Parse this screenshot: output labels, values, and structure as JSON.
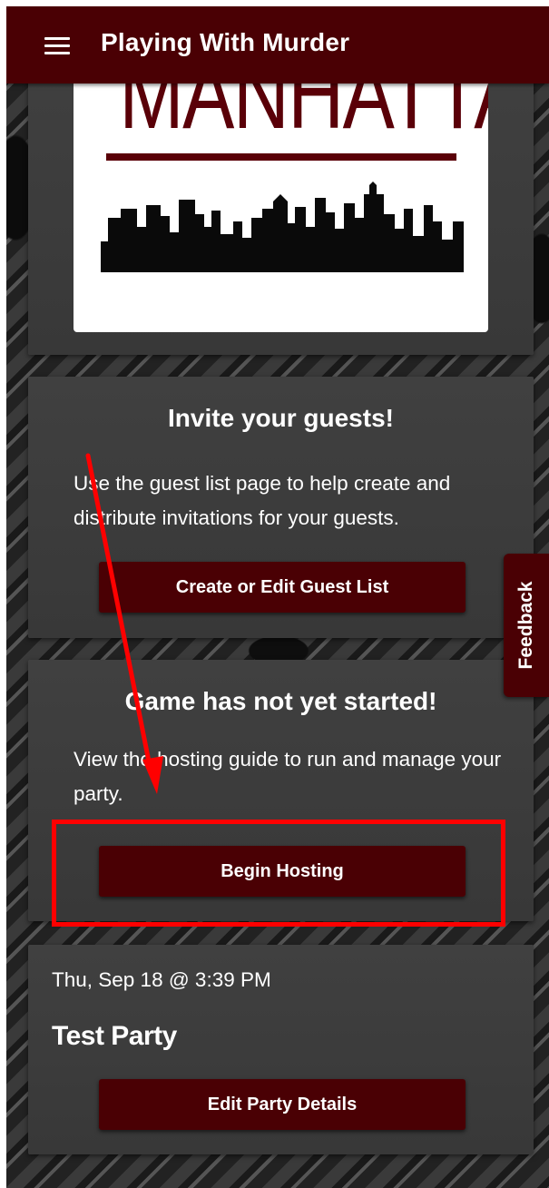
{
  "app": {
    "title": "Playing With Murder",
    "menu_icon": "hamburger-menu-icon"
  },
  "poster": {
    "title": "MANHATTAN",
    "image": "manhattan-skyline"
  },
  "invite_card": {
    "heading": "Invite your guests!",
    "text": "Use the guest list page to help create and distribute invitations for your guests.",
    "button_label": "Create or Edit Guest List"
  },
  "game_card": {
    "heading": "Game has not yet started!",
    "text": "View the hosting guide to run and manage your party.",
    "button_label": "Begin Hosting"
  },
  "party_card": {
    "date": "Thu, Sep 18 @ 3:39 PM",
    "name": "Test Party",
    "button_label": "Edit Party Details"
  },
  "feedback": {
    "label": "Feedback"
  },
  "colors": {
    "brand": "#4a0004",
    "card": "#3c3c3c",
    "annotation": "#ff0000",
    "poster_red": "#5a0008"
  }
}
